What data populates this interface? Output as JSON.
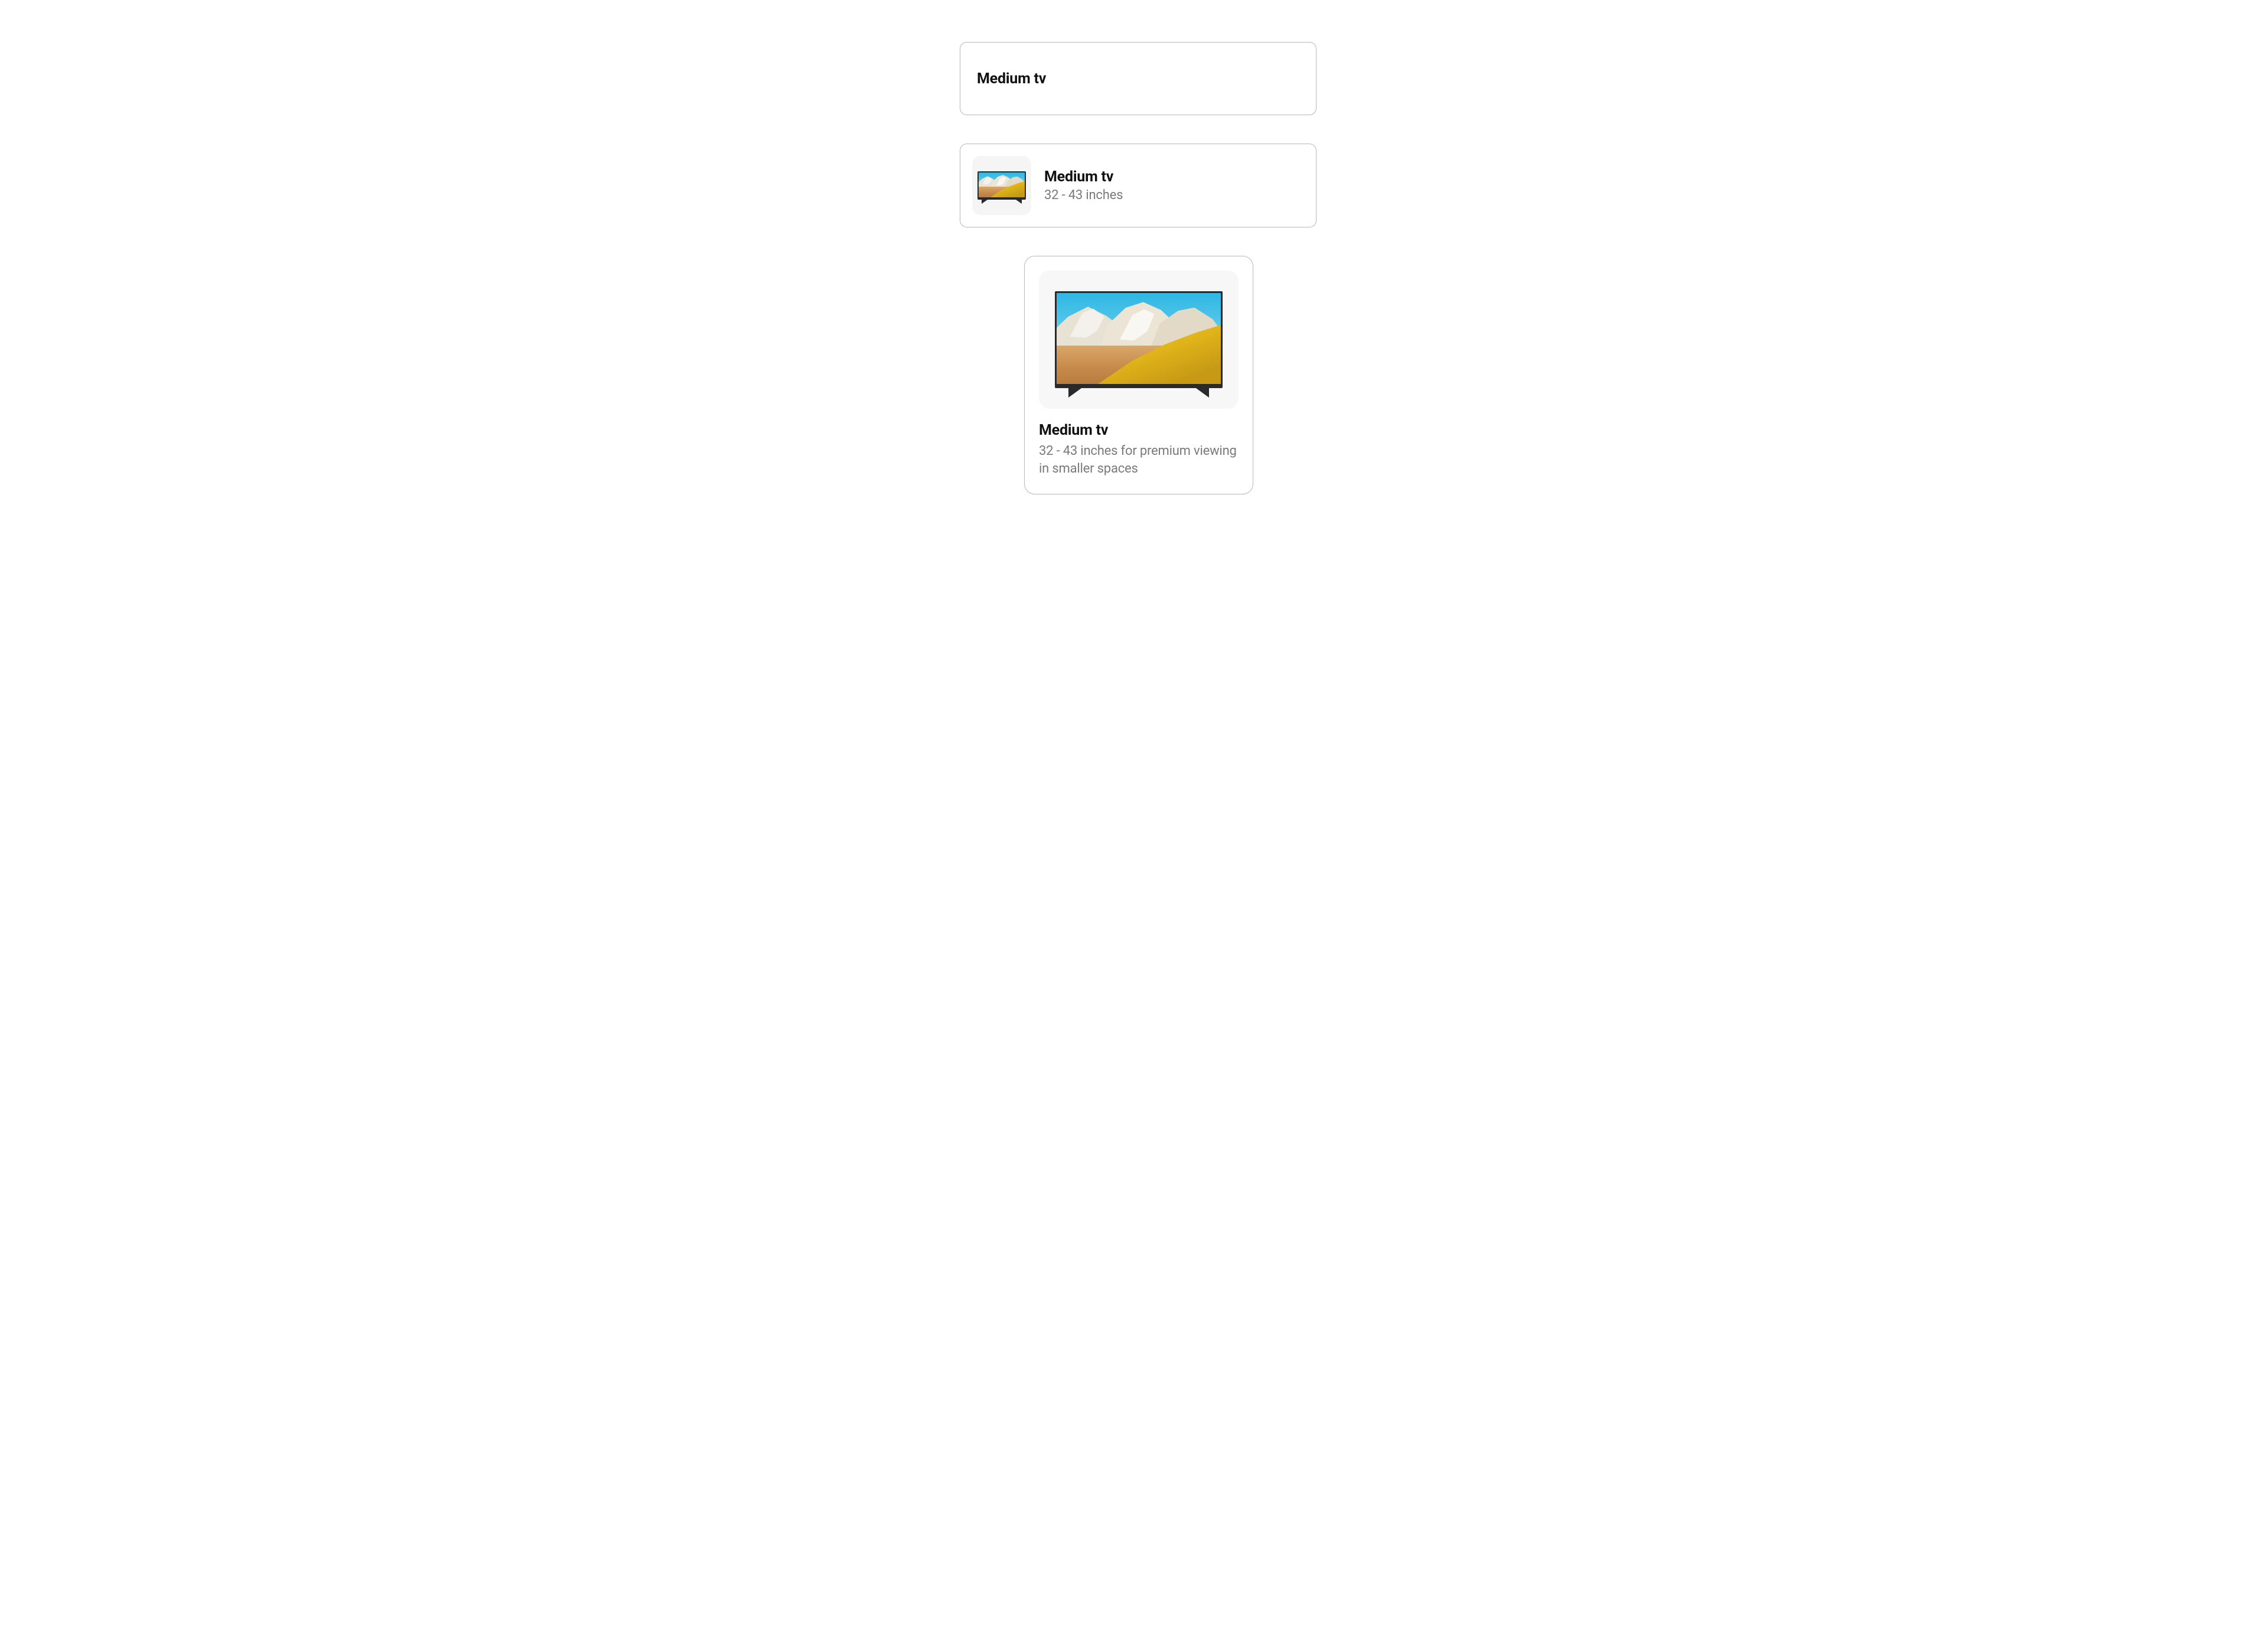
{
  "cards": {
    "simple": {
      "title": "Medium tv"
    },
    "withThumb": {
      "title": "Medium tv",
      "subtitle": "32 - 43 inches",
      "image_alt": "tv-thumbnail"
    },
    "detailed": {
      "title": "Medium tv",
      "description": "32 - 43 inches for premium viewing in smaller spaces",
      "image_alt": "tv-image"
    }
  }
}
